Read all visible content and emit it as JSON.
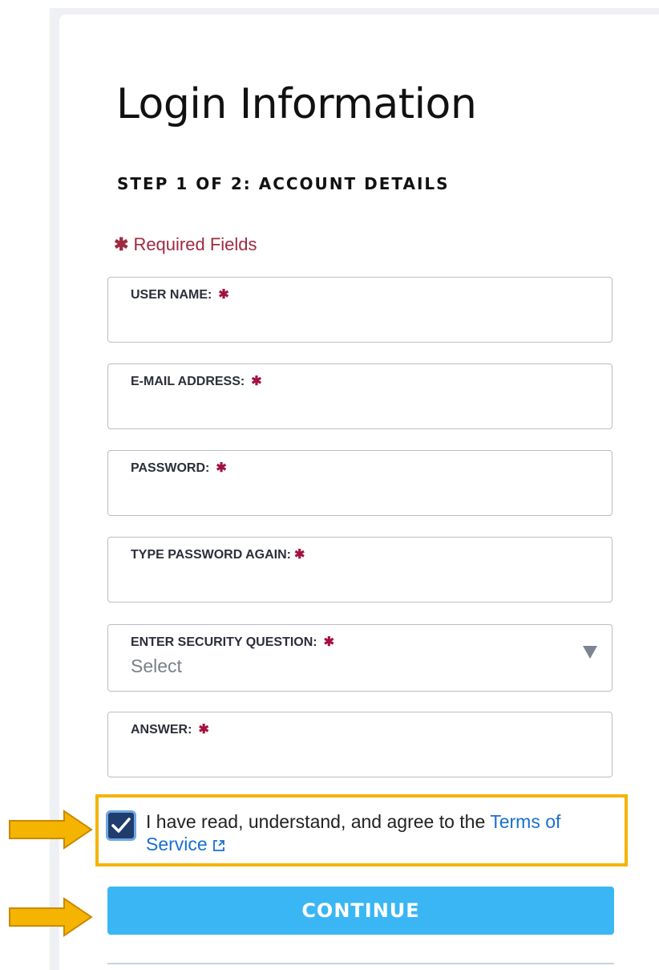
{
  "page": {
    "title": "Login Information",
    "step_label": "STEP 1 OF 2: ACCOUNT DETAILS",
    "required_note": {
      "star": "✱",
      "text": "Required Fields",
      "color": "#9e2a40"
    }
  },
  "fields": {
    "username": {
      "label": "USER NAME:",
      "required_mark": "✱",
      "value": ""
    },
    "email": {
      "label": "E-MAIL ADDRESS:",
      "required_mark": "✱",
      "value": ""
    },
    "password": {
      "label": "PASSWORD:",
      "required_mark": "✱",
      "value": ""
    },
    "password_confirm": {
      "label": "TYPE PASSWORD AGAIN:",
      "required_mark": "✱",
      "value": ""
    },
    "security_question": {
      "label": "ENTER SECURITY QUESTION:",
      "required_mark": "✱",
      "selected": "Select"
    },
    "answer": {
      "label": "ANSWER:",
      "required_mark": "✱",
      "value": ""
    }
  },
  "agreement": {
    "checked": true,
    "text": "I have read, understand, and agree to the ",
    "link_text": "Terms of Service",
    "link_icon": "external-link-icon",
    "highlight_color": "#f4b400"
  },
  "continue_button": {
    "label": "CONTINUE",
    "color": "#3ab6f5"
  },
  "annotations": {
    "arrow_color": "#f4b400",
    "arrow_icon": "right-arrow-icon"
  }
}
